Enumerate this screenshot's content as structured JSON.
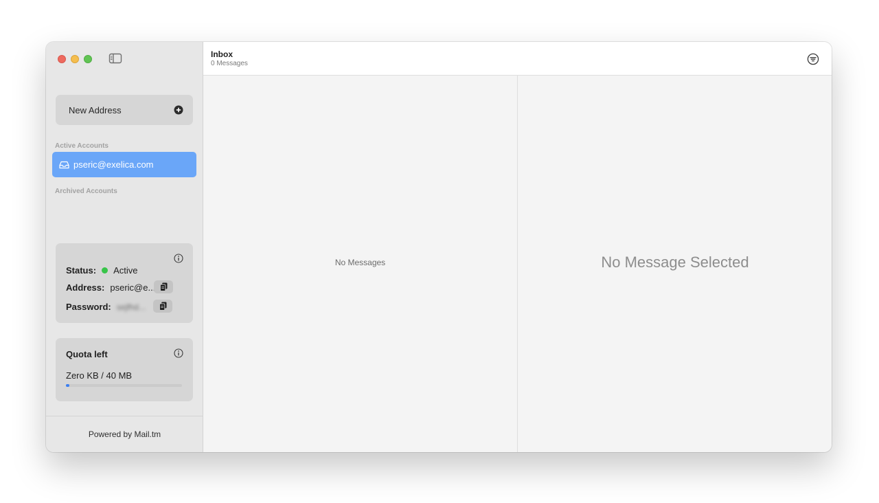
{
  "window": {
    "traffic_lights": [
      "close",
      "minimize",
      "maximize"
    ],
    "sidebar_toggle_icon": "sidebar-icon"
  },
  "sidebar": {
    "new_address_label": "New Address",
    "new_address_icon": "plus-circle-icon",
    "active_accounts_label": "Active Accounts",
    "accounts": [
      {
        "email": "pseric@exelica.com",
        "icon": "inbox-tray-icon",
        "selected": true
      }
    ],
    "archived_accounts_label": "Archived Accounts",
    "status_card": {
      "status_label": "Status:",
      "status_value": "Active",
      "address_label": "Address:",
      "address_value": "pseric@e...",
      "password_label": "Password:",
      "password_value": "sejfhd...",
      "info_icon": "info-circle-icon",
      "copy_icon": "copy-icon",
      "status_color": "#38c449"
    },
    "quota_card": {
      "title": "Quota left",
      "text": "Zero KB / 40 MB",
      "used_fraction": 0.0,
      "info_icon": "info-circle-icon",
      "bar_color": "#3b7ff0"
    },
    "footer_text": "Powered by Mail.tm"
  },
  "header": {
    "title": "Inbox",
    "subtitle": "0 Messages",
    "filter_icon": "filter-circle-icon"
  },
  "message_list": {
    "empty_text": "No Messages"
  },
  "detail": {
    "empty_text": "No Message Selected"
  },
  "colors": {
    "selected_account": "#6aa6f8",
    "accent": "#3b7ff0"
  }
}
